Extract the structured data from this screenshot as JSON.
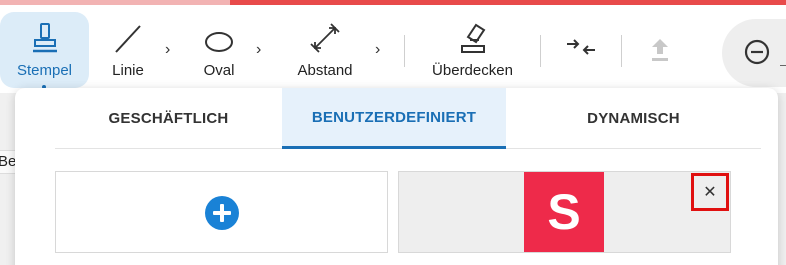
{
  "toolbar": {
    "tools": [
      {
        "label": "Stempel",
        "icon": "stamp-icon",
        "active": true
      },
      {
        "label": "Linie",
        "icon": "line-icon"
      },
      {
        "label": "Oval",
        "icon": "oval-icon"
      },
      {
        "label": "Abstand",
        "icon": "distance-icon"
      },
      {
        "label": "Überdecken",
        "icon": "eraser-icon"
      }
    ],
    "extra_icons": [
      "compress-icon",
      "upload-icon",
      "zoom-out-icon"
    ],
    "chevron": "›"
  },
  "background": {
    "partial_text": "Be"
  },
  "panel": {
    "tabs": [
      {
        "label": "GESCHÄFTLICH",
        "active": false
      },
      {
        "label": "BENUTZERDEFINIERT",
        "active": true
      },
      {
        "label": "DYNAMISCH",
        "active": false
      }
    ],
    "stamp_letter": "S",
    "close_symbol": "✕"
  },
  "colors": {
    "accent": "#1a6fb5",
    "active_tab_bg": "#e6f1fb",
    "stamp_red": "#ee2a4a",
    "highlight_border": "#e01010",
    "top_bar": "#e84a4a"
  }
}
